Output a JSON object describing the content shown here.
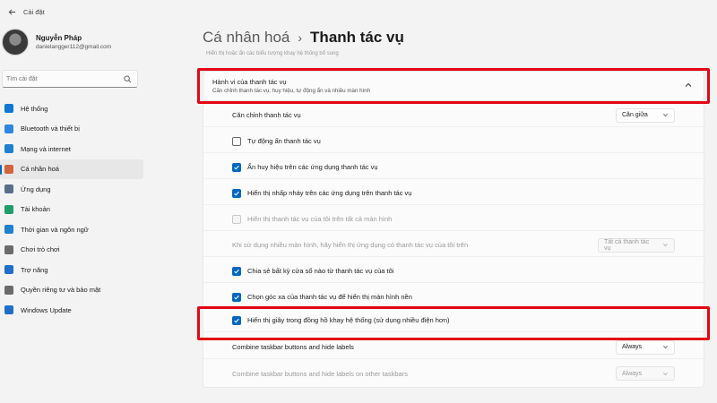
{
  "window": {
    "title": "Cài đặt"
  },
  "profile": {
    "name": "Nguyễn Pháp",
    "email": "danielangger112@gmail.com"
  },
  "search": {
    "placeholder": "Tìm cài đặt"
  },
  "sidebar": {
    "items": [
      {
        "label": "Hệ thống",
        "icon": "system-icon",
        "color": "#0f78d4"
      },
      {
        "label": "Bluetooth và thiết bị",
        "icon": "bluetooth-icon",
        "color": "#2e86de"
      },
      {
        "label": "Mạng và internet",
        "icon": "network-icon",
        "color": "#1f7fd0"
      },
      {
        "label": "Cá nhân hoá",
        "icon": "personalization-icon",
        "color": "#d1643b"
      },
      {
        "label": "Ứng dụng",
        "icon": "apps-icon",
        "color": "#5a6f8c"
      },
      {
        "label": "Tài khoản",
        "icon": "accounts-icon",
        "color": "#1f9e6b"
      },
      {
        "label": "Thời gian và ngôn ngữ",
        "icon": "time-language-icon",
        "color": "#1f7fd0"
      },
      {
        "label": "Chơi trò chơi",
        "icon": "gaming-icon",
        "color": "#6b6b6b"
      },
      {
        "label": "Trợ năng",
        "icon": "accessibility-icon",
        "color": "#1f6fc9"
      },
      {
        "label": "Quyền riêng tư và bảo mật",
        "icon": "privacy-icon",
        "color": "#6b6b6b"
      },
      {
        "label": "Windows Update",
        "icon": "windows-update-icon",
        "color": "#1f6fc9"
      }
    ],
    "active_index": 3
  },
  "breadcrumb": {
    "parent": "Cá nhân hoá",
    "separator": "›",
    "current": "Thanh tác vụ"
  },
  "faded_text": "Hiển thị hoặc ẩn các biểu tượng khay hệ thống bổ sung",
  "section": {
    "title": "Hành vi của thanh tác vụ",
    "subtitle": "Căn chỉnh thanh tác vụ, huy hiệu, tự động ẩn và nhiều màn hình"
  },
  "settings": {
    "alignment": {
      "label": "Căn chỉnh thanh tác vụ",
      "value": "Căn giữa"
    },
    "auto_hide": {
      "label": "Tự động ẩn thanh tác vụ",
      "checked": false
    },
    "badges": {
      "label": "Ẩn huy hiệu trên các ứng dụng thanh tác vụ",
      "checked": true
    },
    "flashing": {
      "label": "Hiển thị nhấp nháy trên các ứng dụng trên thanh tác vụ",
      "checked": true
    },
    "all_displays": {
      "label": "Hiển thị thanh tác vụ của tôi trên tất cả màn hình",
      "checked": false,
      "disabled": true
    },
    "multi_display": {
      "label": "Khi sử dụng nhiều màn hình, hãy hiển thị ứng dụng có thanh tác vụ của tôi trên",
      "value": "Tất cả thanh tác vụ",
      "disabled": true
    },
    "share_window": {
      "label": "Chia sẻ bất kỳ cửa sổ nào từ thanh tác vụ của tôi",
      "checked": true
    },
    "far_corner": {
      "label": "Chọn góc xa của thanh tác vụ để hiển thị màn hình nền",
      "checked": true
    },
    "seconds_clock": {
      "label": "Hiển thị giây trong đồng hồ khay hệ thống (sử dụng nhiều điện hơn)",
      "checked": true
    },
    "combine": {
      "label": "Combine taskbar buttons and hide labels",
      "value": "Always"
    },
    "combine_other": {
      "label": "Combine taskbar buttons and hide labels on other taskbars",
      "value": "Always",
      "disabled": true
    }
  },
  "colors": {
    "accent": "#0067c0",
    "highlight": "#e30613"
  }
}
